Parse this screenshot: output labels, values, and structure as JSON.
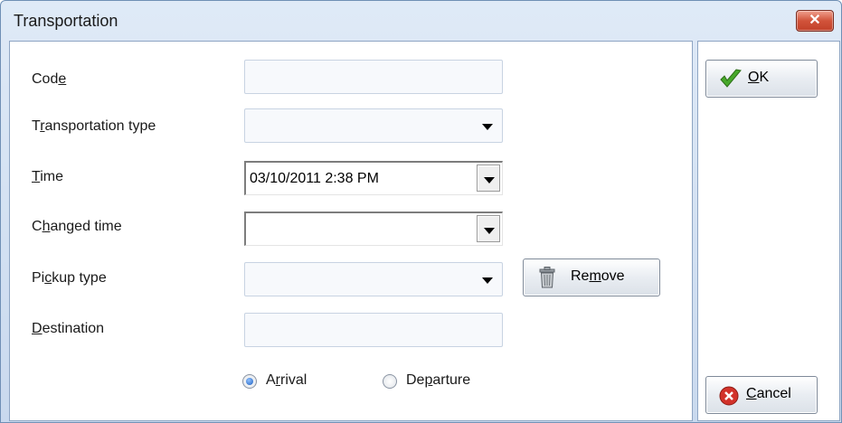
{
  "window": {
    "title": "Transportation",
    "close_label": "✕"
  },
  "form": {
    "code": {
      "label_pre": "Cod",
      "label_key": "e",
      "label_post": "",
      "value": ""
    },
    "transportation_type": {
      "label_pre": "T",
      "label_key": "r",
      "label_post": "ansportation type",
      "value": ""
    },
    "time": {
      "label_pre": "",
      "label_key": "T",
      "label_post": "ime",
      "value": "03/10/2011 2:38 PM"
    },
    "changed_time": {
      "label_pre": "C",
      "label_key": "h",
      "label_post": "anged time",
      "value": ""
    },
    "pickup_type": {
      "label_pre": "Pi",
      "label_key": "c",
      "label_post": "kup type",
      "value": ""
    },
    "destination": {
      "label_pre": "",
      "label_key": "D",
      "label_post": "estination",
      "value": ""
    }
  },
  "remove_button": {
    "label_pre": "Re",
    "label_key": "m",
    "label_post": "ove",
    "icon": "trash-icon"
  },
  "direction": {
    "arrival": {
      "label_pre": "A",
      "label_key": "r",
      "label_post": "rival",
      "selected": true
    },
    "departure": {
      "label_pre": "De",
      "label_key": "p",
      "label_post": "arture",
      "selected": false
    }
  },
  "ok_button": {
    "label_pre": "",
    "label_key": "O",
    "label_post": "K",
    "icon": "checkmark-icon"
  },
  "cancel_button": {
    "label_pre": "",
    "label_key": "C",
    "label_post": "ancel",
    "icon": "cancel-icon"
  }
}
